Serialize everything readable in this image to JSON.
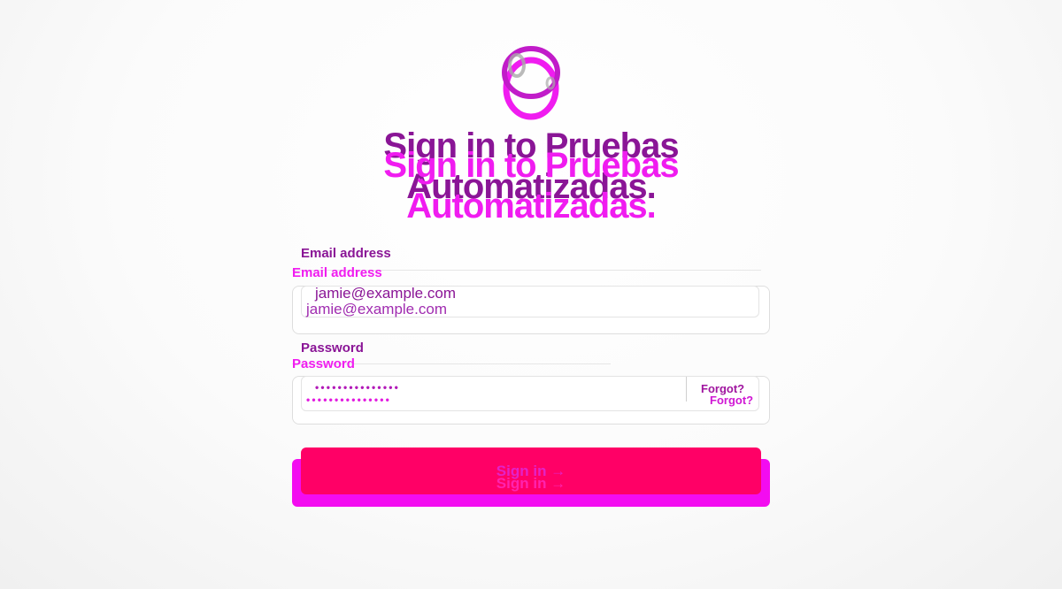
{
  "heading": {
    "line1": "Sign in to Pruebas",
    "line2": "Automatizadas."
  },
  "email": {
    "label": "Email address",
    "value": "jamie@example.com"
  },
  "password": {
    "label": "Password",
    "masked": "•••••••••••••••",
    "forgot_label": "Forgot?"
  },
  "submit": {
    "label": "Sign in →"
  },
  "logo": {
    "icon": "interlocking-rings-icon"
  },
  "colors": {
    "accent_dark": "#8a1596",
    "accent_magenta": "#f01cf0",
    "button_pink": "#ff0066",
    "button_magenta": "#f30cf0"
  }
}
